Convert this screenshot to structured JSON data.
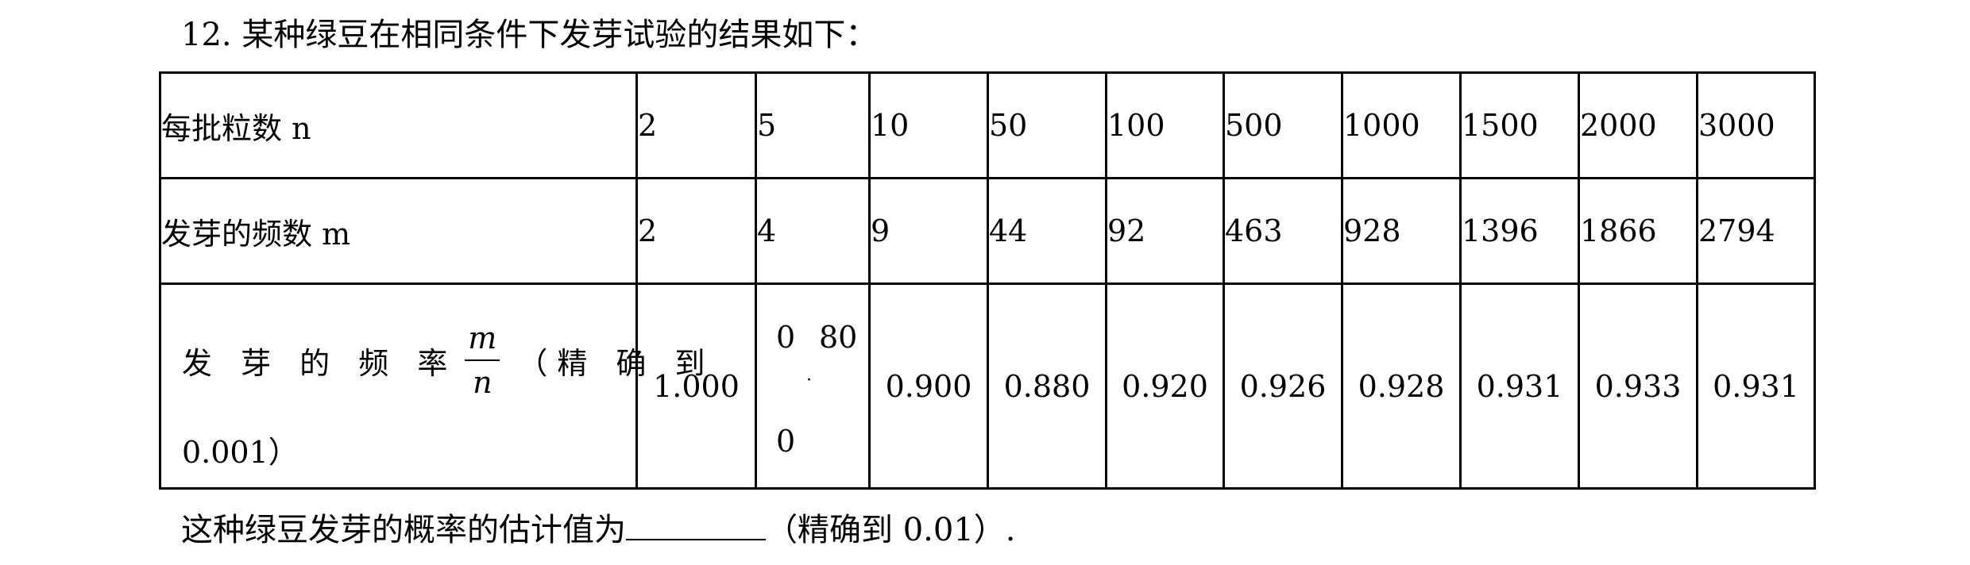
{
  "question": {
    "number": "12.",
    "title": "某种绿豆在相同条件下发芽试验的结果如下："
  },
  "table": {
    "row_n_label": "每批粒数 n",
    "row_m_label": "发芽的频数 m",
    "row_f_label_main": "发 芽 的 频 率",
    "row_f_numerator": "m",
    "row_f_denominator": "n",
    "row_f_label_tail": "（精 确 到",
    "row_f_label_line2": "0.001）",
    "n_values": [
      "2",
      "5",
      "10",
      "50",
      "100",
      "500",
      "1000",
      "1500",
      "2000",
      "3000"
    ],
    "m_values": [
      "2",
      "4",
      "9",
      "44",
      "92",
      "463",
      "928",
      "1396",
      "1866",
      "2794"
    ],
    "f_values": [
      "1.000",
      "",
      "0.900",
      "0.880",
      "0.920",
      "0.926",
      "0.928",
      "0.931",
      "0.933",
      "0.931"
    ],
    "f_broken_cell": {
      "part1": "0",
      "part2": "80",
      "dot": "·",
      "part3": "0"
    }
  },
  "footer": {
    "prefix": "这种绿豆发芽的概率的估计值为",
    "suffix": "（精确到 0.01）."
  }
}
